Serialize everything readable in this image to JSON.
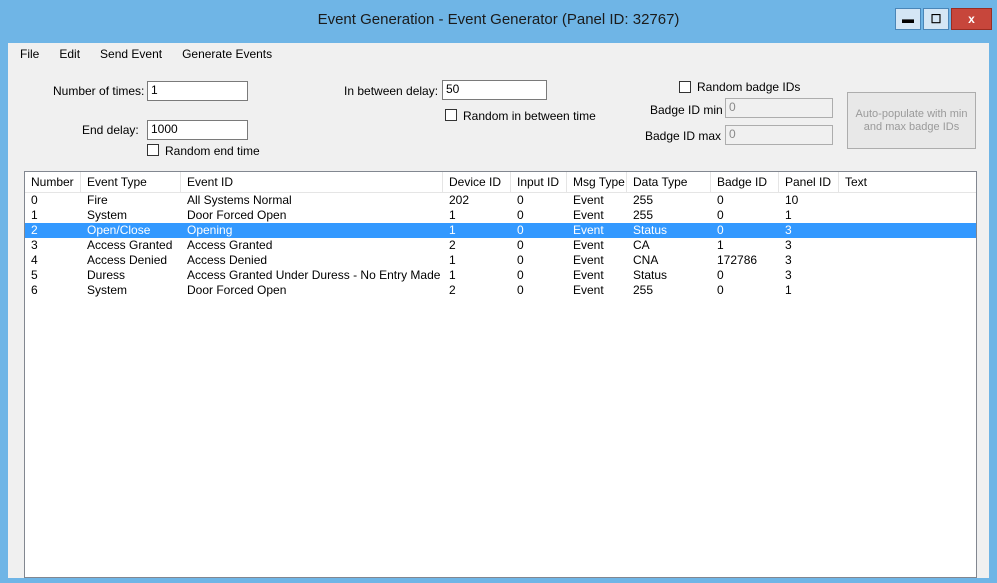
{
  "window": {
    "title": "Event Generation - Event Generator (Panel ID: 32767)",
    "min_glyph": "▬",
    "max_glyph": "☐",
    "close_glyph": "x"
  },
  "menu": [
    "File",
    "Edit",
    "Send Event",
    "Generate Events"
  ],
  "form": {
    "number_of_times_label": "Number of times:",
    "number_of_times_value": "1",
    "end_delay_label": "End delay:",
    "end_delay_value": "1000",
    "random_end_time_label": "Random end time",
    "in_between_delay_label": "In between delay:",
    "in_between_delay_value": "50",
    "random_in_between_label": "Random in between time",
    "random_badge_label": "Random badge IDs",
    "badge_min_label": "Badge ID min",
    "badge_min_value": "0",
    "badge_max_label": "Badge ID max",
    "badge_max_value": "0",
    "auto_populate_label": "Auto-populate with min and max badge IDs"
  },
  "table": {
    "columns": [
      "Number",
      "Event Type",
      "Event ID",
      "Device ID",
      "Input ID",
      "Msg Type",
      "Data Type",
      "Badge ID",
      "Panel ID",
      "Text"
    ],
    "rows": [
      [
        "0",
        "Fire",
        "All Systems Normal",
        "202",
        "0",
        "Event",
        "255",
        "0",
        "10",
        ""
      ],
      [
        "1",
        "System",
        "Door Forced Open",
        "1",
        "0",
        "Event",
        "255",
        "0",
        "1",
        ""
      ],
      [
        "2",
        "Open/Close",
        "Opening",
        "1",
        "0",
        "Event",
        "Status",
        "0",
        "3",
        ""
      ],
      [
        "3",
        "Access Granted",
        "Access Granted",
        "2",
        "0",
        "Event",
        "CA",
        "1",
        "3",
        ""
      ],
      [
        "4",
        "Access Denied",
        "Access Denied",
        "1",
        "0",
        "Event",
        "CNA",
        "172786",
        "3",
        ""
      ],
      [
        "5",
        "Duress",
        "Access Granted Under Duress - No Entry Made",
        "1",
        "0",
        "Event",
        "Status",
        "0",
        "3",
        ""
      ],
      [
        "6",
        "System",
        "Door Forced Open",
        "2",
        "0",
        "Event",
        "255",
        "0",
        "1",
        ""
      ]
    ],
    "selected_index": 2
  }
}
